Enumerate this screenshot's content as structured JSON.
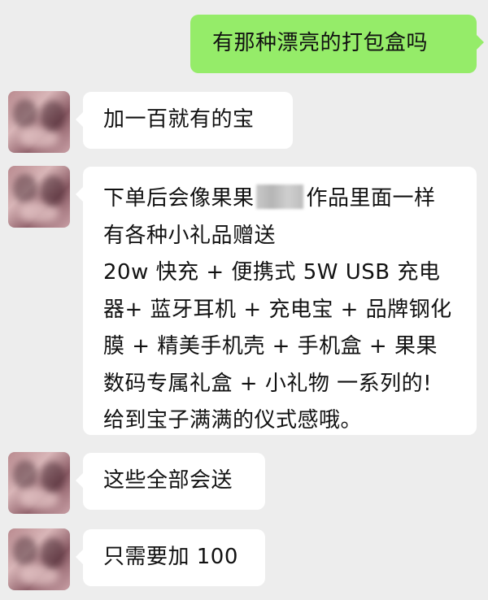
{
  "chat": {
    "sent": {
      "text": "有那种漂亮的打包盒吗"
    },
    "received": [
      {
        "text": "加一百就有的宝"
      },
      {
        "line1_before": "下单后会像果果",
        "line1_after": "作品里面一样",
        "line2": "有各种小礼品赠送",
        "line3": "20w 快充 + 便携式 5W USB 充电",
        "line4": "器+ 蓝牙耳机 + 充电宝 + 品牌钢化",
        "line5": "膜 + 精美手机壳 + 手机盒 + 果果",
        "line6": "数码专属礼盒 + 小礼物 一系列的!",
        "line7": "给到宝子满满的仪式感哦。"
      },
      {
        "text": "这些全部会送"
      },
      {
        "text": "只需要加 100"
      }
    ]
  },
  "colors": {
    "background": "#ededed",
    "sent_bubble": "#95ec69",
    "received_bubble": "#ffffff",
    "text": "#111111"
  }
}
